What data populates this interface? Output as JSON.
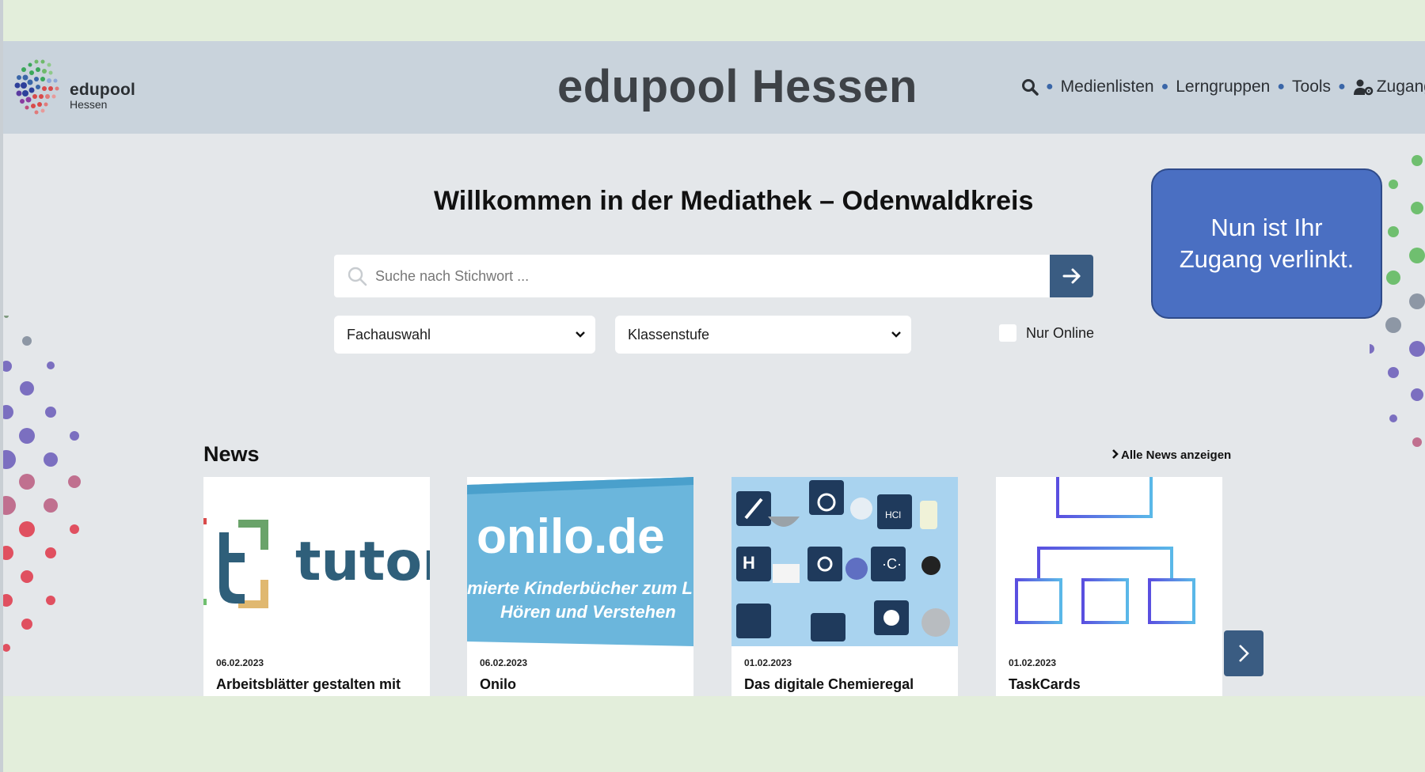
{
  "header": {
    "logo_name": "edupool",
    "logo_sub": "Hessen",
    "site_title": "edupool Hessen",
    "nav": {
      "medienlisten": "Medienlisten",
      "lerngruppen": "Lerngruppen",
      "tools": "Tools",
      "zugang": "Zugang"
    }
  },
  "main": {
    "welcome": "Willkommen in der Mediathek – Odenwaldkreis",
    "search": {
      "placeholder": "Suche nach Stichwort ..."
    },
    "filters": {
      "subject": "Fachauswahl",
      "grade": "Klassenstufe",
      "online_only": "Nur Online"
    },
    "callout": "Nun ist Ihr Zugang verlinkt.",
    "news": {
      "title": "News",
      "all_link": "Alle News anzeigen",
      "items": [
        {
          "date": "06.02.2023",
          "title": "Arbeitsblätter gestalten mit",
          "thumb_text": "tutory"
        },
        {
          "date": "06.02.2023",
          "title": "Onilo",
          "thumb_text": "onilo.de",
          "thumb_line1": "mierte Kinderbücher zum L",
          "thumb_line2": "Hören und Verstehen"
        },
        {
          "date": "01.02.2023",
          "title": "Das digitale Chemieregal"
        },
        {
          "date": "01.02.2023",
          "title": "TaskCards"
        }
      ]
    }
  },
  "colors": {
    "frame": "#e3eedb",
    "header": "#c9d3dc",
    "main": "#e4e7ea",
    "accent": "#3a5c82",
    "callout": "#4a6fc2",
    "nav_dot": "#3a66a8"
  }
}
